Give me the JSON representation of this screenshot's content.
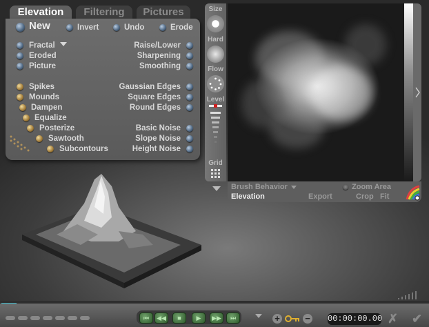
{
  "tabs": [
    {
      "label": "Elevation",
      "active": true
    },
    {
      "label": "Filtering",
      "active": false
    },
    {
      "label": "Pictures",
      "active": false
    }
  ],
  "panel": {
    "top": [
      {
        "label": "New"
      },
      {
        "label": "Invert"
      },
      {
        "label": "Undo"
      },
      {
        "label": "Erode"
      }
    ],
    "left_group1": [
      "Fractal",
      "Eroded",
      "Picture"
    ],
    "right_group1": [
      "Raise/Lower",
      "Sharpening",
      "Smoothing"
    ],
    "left_group2": [
      "Spikes",
      "Mounds",
      "Dampen",
      "Equalize",
      "Posterize",
      "Sawtooth",
      "Subcontours"
    ],
    "right_group2": [
      "Gaussian Edges",
      "Square Edges",
      "Round Edges",
      "Basic Noise",
      "Slope Noise",
      "Height Noise"
    ]
  },
  "brush": {
    "size": "Size",
    "hard": "Hard",
    "flow": "Flow",
    "level": "Level",
    "grid": "Grid"
  },
  "preview_bar": {
    "brush_behavior": "Brush Behavior",
    "zoom_area": "Zoom Area",
    "elevation": "Elevation",
    "export": "Export",
    "crop": "Crop",
    "fit": "Fit"
  },
  "transport": {
    "time": "00:00:00.00"
  },
  "colors": {
    "panel": "#5f5f5f",
    "dot_blue": "#4c6580",
    "dot_gold": "#a07a38",
    "transport_green": "#2f5a2c"
  },
  "icons": [
    "chevron-down-icon",
    "fractal-chain-icon",
    "grid-icon",
    "color-wheel-icon",
    "key-icon",
    "plus-icon",
    "minus-icon",
    "close-icon",
    "check-icon",
    "play-icon",
    "stop-icon",
    "rewind-icon",
    "fast-forward-icon"
  ]
}
